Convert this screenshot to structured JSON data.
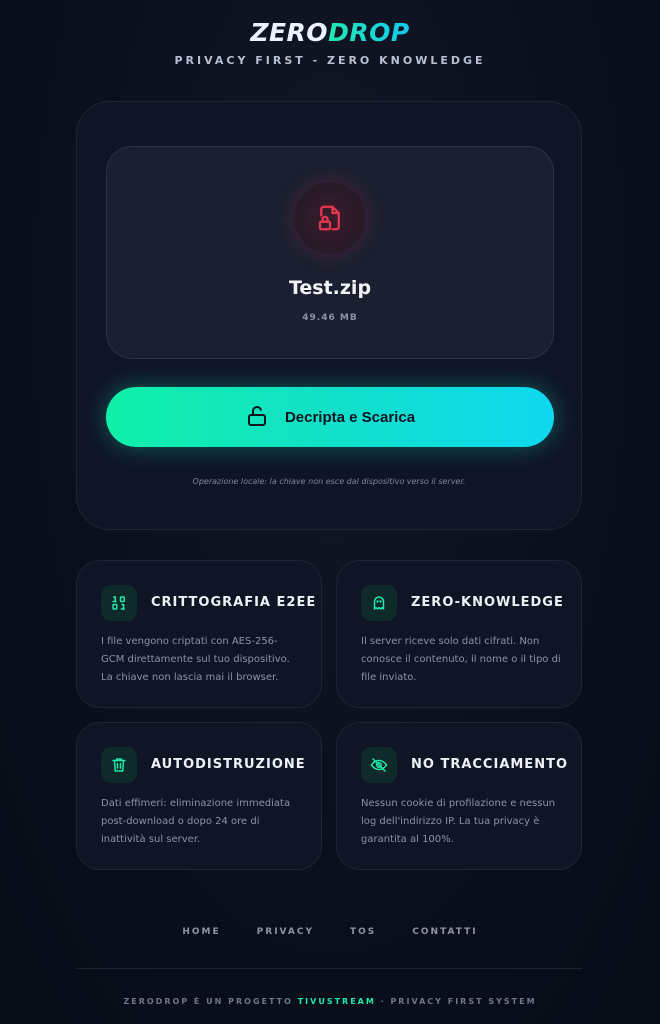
{
  "header": {
    "logo_part1": "ZERO",
    "logo_part2": "DROP",
    "tagline": "PRIVACY FIRST - ZERO KNOWLEDGE"
  },
  "file": {
    "icon": "locked-file-icon",
    "name": "Test.zip",
    "size": "49.46 MB"
  },
  "action": {
    "icon": "unlock-icon",
    "label": "Decripta e Scarica",
    "note": "Operazione locale: la chiave non esce dal dispositivo verso il server."
  },
  "features": [
    {
      "icon": "binary-icon",
      "title": "CRITTOGRAFIA E2EE",
      "desc": "I file vengono criptati con AES-256-GCM direttamente sul tuo dispositivo. La chiave non lascia mai il browser."
    },
    {
      "icon": "ghost-icon",
      "title": "ZERO-KNOWLEDGE",
      "desc": "Il server riceve solo dati cifrati. Non conosce il contenuto, il nome o il tipo di file inviato."
    },
    {
      "icon": "trash-icon",
      "title": "AUTODISTRUZIONE",
      "desc": "Dati effimeri: eliminazione immediata post-download o dopo 24 ore di inattività sul server."
    },
    {
      "icon": "eye-off-icon",
      "title": "NO TRACCIAMENTO",
      "desc": "Nessun cookie di profilazione e nessun log dell'indirizzo IP. La tua privacy è garantita al 100%."
    }
  ],
  "footer": {
    "nav": [
      "HOME",
      "PRIVACY",
      "TOS",
      "CONTATTI"
    ],
    "credit_prefix": "ZERODROP È UN PROGETTO ",
    "credit_brand": "TIVUSTREAM",
    "credit_suffix": " · PRIVACY FIRST SYSTEM"
  },
  "colors": {
    "accent": "#14e8b8",
    "danger_icon": "#e8364f",
    "background": "#0a0f1c"
  }
}
